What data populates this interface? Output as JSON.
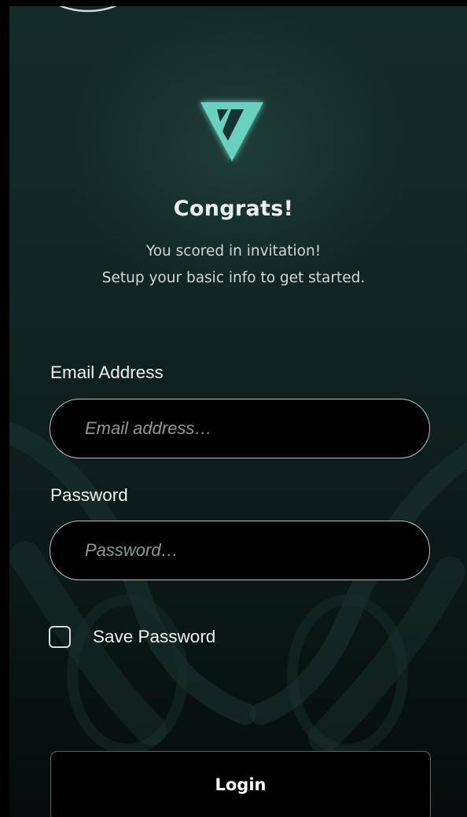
{
  "header": {
    "logo_icon": "triangle-v-logo-icon",
    "title": "Congrats!",
    "subtitle_line1": "You scored in invitation!",
    "subtitle_line2": "Setup your basic info to get started."
  },
  "form": {
    "email": {
      "label": "Email Address",
      "placeholder": "Email address…",
      "value": ""
    },
    "password": {
      "label": "Password",
      "placeholder": "Password…",
      "value": ""
    },
    "save_password": {
      "label": "Save Password",
      "checked": false
    },
    "login_label": "Login"
  },
  "colors": {
    "accent": "#6ad0bf",
    "background_top": "#142c29",
    "background_bottom": "#050c0b",
    "text_primary": "#eef2f1"
  }
}
